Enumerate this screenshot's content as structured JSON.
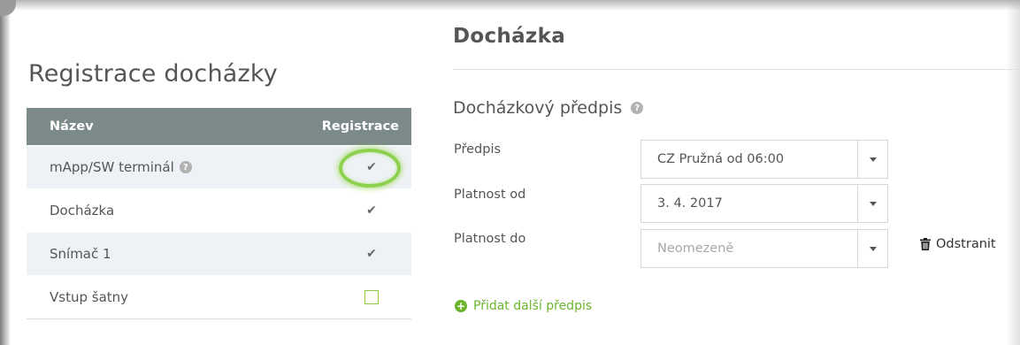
{
  "registration": {
    "title": "Registrace docházky",
    "columns": {
      "name": "Název",
      "registration": "Registrace"
    },
    "rows": [
      {
        "name": "mApp/SW terminál",
        "checked": true,
        "has_help": true,
        "highlighted": true
      },
      {
        "name": "Docházka",
        "checked": true
      },
      {
        "name": "Snímač 1",
        "checked": true
      },
      {
        "name": "Vstup šatny",
        "checked": false
      }
    ]
  },
  "attendance": {
    "title": "Docházka",
    "section_title": "Docházkový předpis",
    "fields": [
      {
        "label": "Předpis",
        "value": "CZ Pružná od 06:00"
      },
      {
        "label": "Platnost od",
        "value": "3. 4. 2017"
      },
      {
        "label": "Platnost do",
        "placeholder": "Neomezeně"
      }
    ],
    "remove_label": "Odstranit",
    "add_label": "Přidat další předpis"
  },
  "colors": {
    "accent_green": "#6ab42e",
    "table_header": "#7c8b8a",
    "row_shade": "#eef2f6"
  },
  "icons": {
    "help": "question-circle-icon",
    "check": "check-icon",
    "trash": "trash-icon",
    "plus": "plus-circle-icon",
    "dropdown": "chevron-down-icon"
  }
}
